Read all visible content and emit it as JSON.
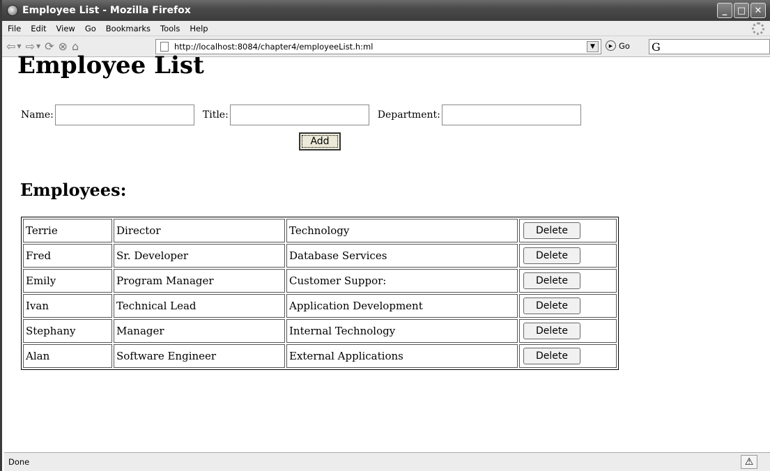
{
  "window": {
    "title": "Employee List - Mozilla Firefox"
  },
  "menubar": {
    "items": [
      "File",
      "Edit",
      "View",
      "Go",
      "Bookmarks",
      "Tools",
      "Help"
    ]
  },
  "navbar": {
    "url": "http://localhost:8084/chapter4/employeeList.h:ml",
    "go_label": "Go",
    "search_icon_text": "G"
  },
  "page": {
    "title": "Employee List",
    "form": {
      "name_label": "Name:",
      "title_label": "Title:",
      "department_label": "Department:",
      "name_value": "",
      "title_value": "",
      "department_value": "",
      "add_label": "Add"
    },
    "section_title": "Employees:",
    "delete_label": "Delete",
    "employees": [
      {
        "name": "Terrie",
        "title": "Director",
        "department": "Technology"
      },
      {
        "name": "Fred",
        "title": "Sr. Developer",
        "department": "Database Services"
      },
      {
        "name": "Emily",
        "title": "Program Manager",
        "department": "Customer Suppor:"
      },
      {
        "name": "Ivan",
        "title": "Technical Lead",
        "department": "Application Development"
      },
      {
        "name": "Stephany",
        "title": "Manager",
        "department": "Internal Technology"
      },
      {
        "name": "Alan",
        "title": "Software Engineer",
        "department": "External Applications"
      }
    ]
  },
  "statusbar": {
    "text": "Done"
  }
}
